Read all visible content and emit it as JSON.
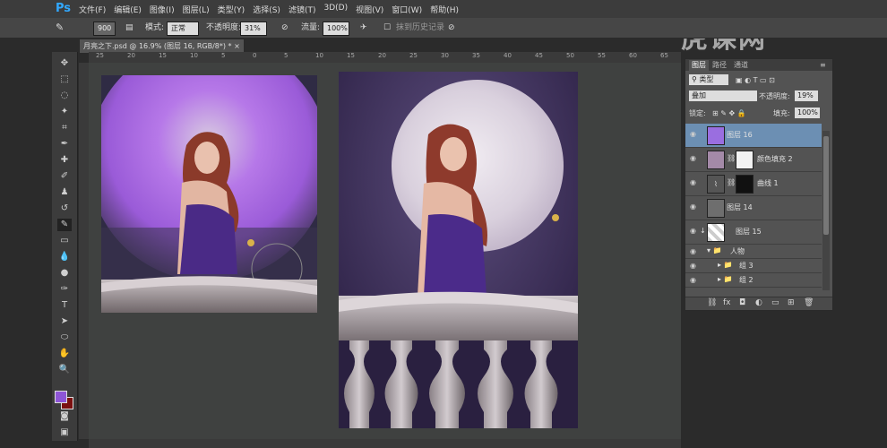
{
  "app": {
    "logo": "Ps"
  },
  "menu": [
    "文件(F)",
    "编辑(E)",
    "图像(I)",
    "图层(L)",
    "类型(Y)",
    "选择(S)",
    "滤镜(T)",
    "3D(D)",
    "视图(V)",
    "窗口(W)",
    "帮助(H)"
  ],
  "options": {
    "brush_size": "900",
    "mode_label": "模式:",
    "mode_value": "正常",
    "opacity_label": "不透明度:",
    "opacity_value": "31%",
    "flow_label": "流量:",
    "flow_value": "100%",
    "erase_history_label": "抹到历史记录"
  },
  "document": {
    "tab_title": "月亮之下.psd @ 16.9% (图层 16, RGB/8*) *"
  },
  "ruler_ticks": [
    "25",
    "20",
    "15",
    "10",
    "5",
    "0",
    "5",
    "10",
    "15",
    "20",
    "25",
    "30",
    "35",
    "40",
    "45",
    "50",
    "55",
    "60",
    "65"
  ],
  "watermark": "虎课网",
  "layers_panel": {
    "tabs": [
      "图层",
      "路径",
      "通道"
    ],
    "filter_label": "类型",
    "blend_mode": "叠加",
    "opacity_label": "不透明度:",
    "opacity_value": "19%",
    "lock_label": "锁定:",
    "fill_label": "填充:",
    "fill_value": "100%",
    "layers": [
      {
        "name": "图层 16",
        "selected": true
      },
      {
        "name": "颜色填充 2",
        "selected": false
      },
      {
        "name": "曲线 1",
        "selected": false
      },
      {
        "name": "图层 14",
        "selected": false
      },
      {
        "name": "图层 15",
        "selected": false
      }
    ],
    "groups": [
      {
        "name": "人物",
        "expanded": true
      },
      {
        "name": "组 3",
        "expanded": false
      },
      {
        "name": "组 2",
        "expanded": false
      }
    ]
  },
  "colors": {
    "foreground": "#8e55d6",
    "background": "#7a1010",
    "accent": "#31a8ff"
  }
}
